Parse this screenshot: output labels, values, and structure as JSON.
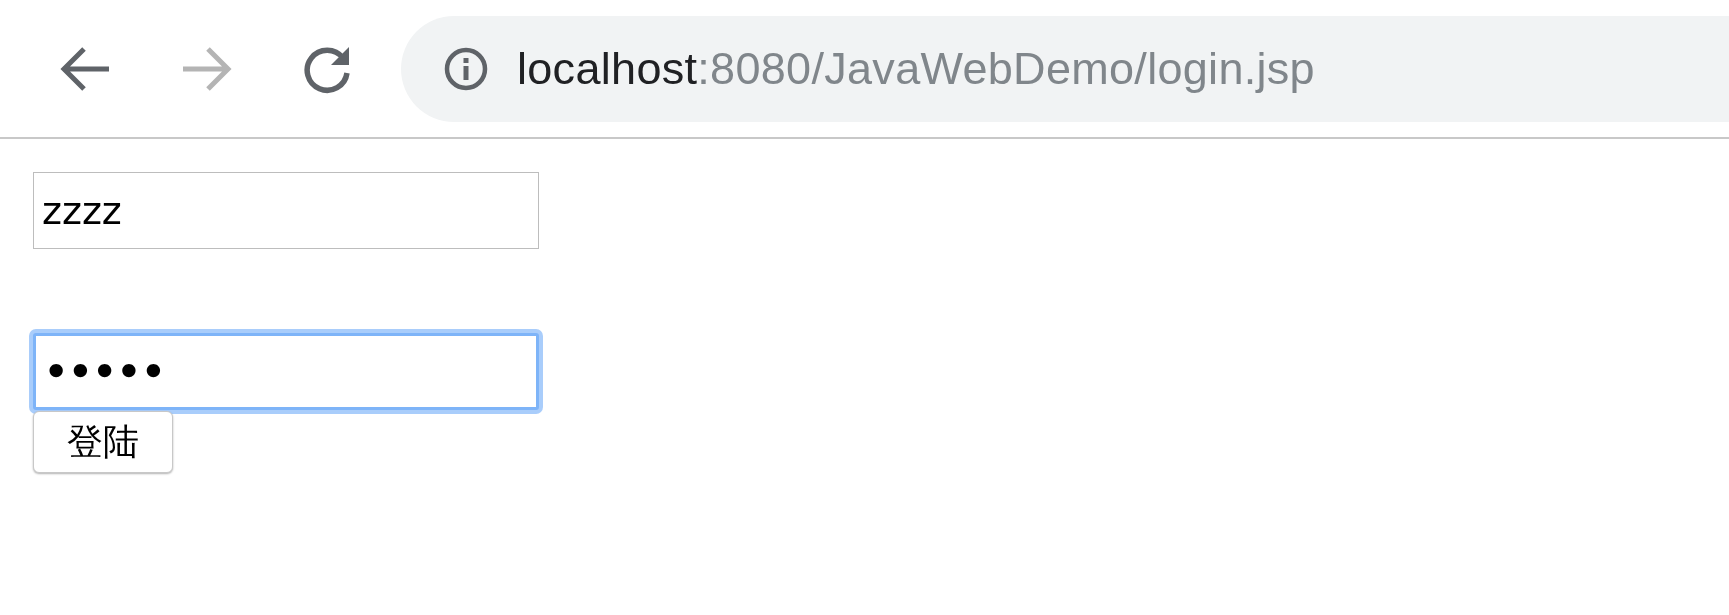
{
  "toolbar": {
    "back": {
      "disabled": false
    },
    "forward": {
      "disabled": true
    },
    "address": {
      "host": "localhost",
      "path": ":8080/JavaWebDemo/login.jsp"
    }
  },
  "form": {
    "username": {
      "value": "zzzz",
      "focused": false
    },
    "password": {
      "value": "•••••",
      "focused": true
    },
    "submit": {
      "label": "登陆"
    }
  }
}
